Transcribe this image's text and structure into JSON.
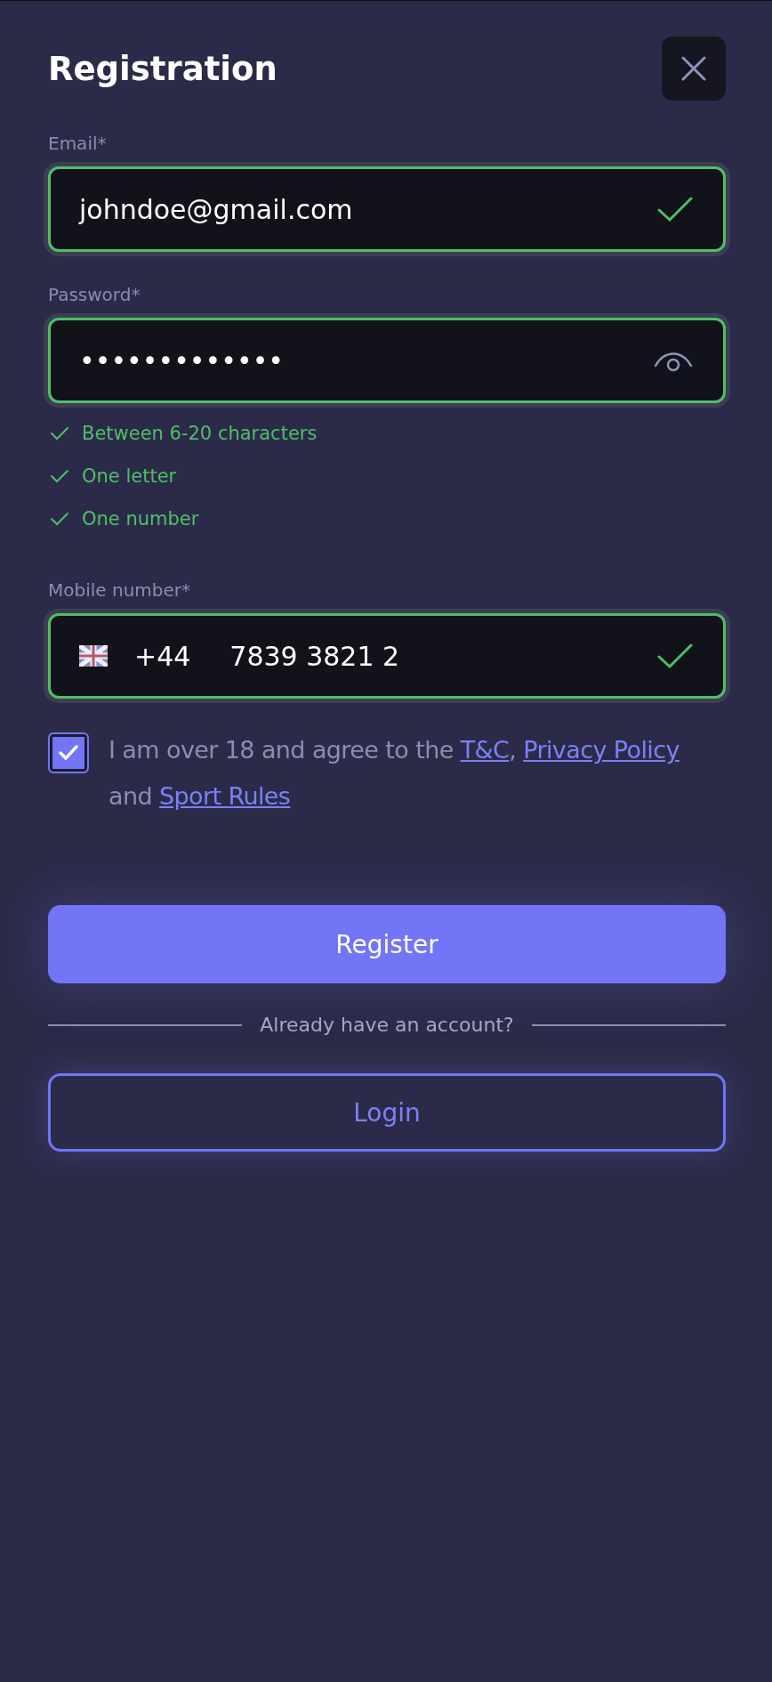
{
  "title": "Registration",
  "fields": [
    {
      "kind": "email",
      "label": "Email*",
      "value": "johndoe@gmail.com",
      "valid": true
    },
    {
      "kind": "password",
      "label": "Password*",
      "value": "•••••••••••••",
      "valid": true
    },
    {
      "kind": "phone",
      "label": "Mobile number*",
      "code": "+44",
      "value": "7839 3821 2",
      "valid": true
    }
  ],
  "requirements": [
    {
      "text": "Between 6-20 characters",
      "met": true
    },
    {
      "text": "One letter",
      "met": true
    },
    {
      "text": "One number",
      "met": true
    }
  ],
  "consent": {
    "checked": true,
    "parts": [
      {
        "kind": "text",
        "text": "I am over 18 and agree to the "
      },
      {
        "kind": "link",
        "text": "T&C"
      },
      {
        "kind": "text",
        "text": ", "
      },
      {
        "kind": "link",
        "text": "Privacy Policy"
      },
      {
        "kind": "text",
        "text": " and "
      },
      {
        "kind": "link",
        "text": "Sport Rules"
      }
    ]
  },
  "register_button": "Register",
  "divider_text": "Already have an account?",
  "login_button": "Login"
}
